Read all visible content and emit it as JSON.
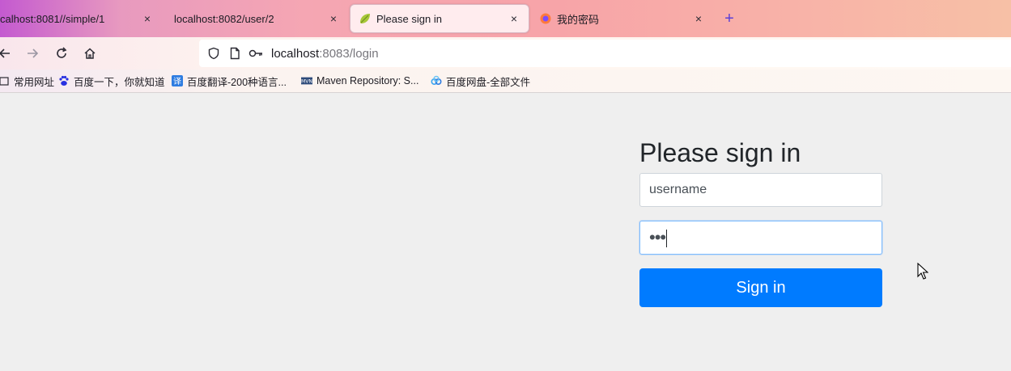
{
  "tabs": [
    {
      "title": "calhost:8081//simple/1",
      "close": "×",
      "active": false
    },
    {
      "title": "localhost:8082/user/2",
      "close": "×",
      "active": false
    },
    {
      "title": "Please sign in",
      "close": "×",
      "active": true
    },
    {
      "title": "我的密码",
      "close": "×",
      "active": false
    }
  ],
  "new_tab": "+",
  "nav": {
    "url_host": "localhost",
    "url_rest": ":8083/login"
  },
  "bookmarks": [
    {
      "label": "常用网址",
      "icon": "folder-icon"
    },
    {
      "label": "百度一下，你就知道",
      "icon": "baidu-paw-icon"
    },
    {
      "label": "百度翻译-200种语言...",
      "icon": "translate-icon"
    },
    {
      "label": "Maven Repository: S...",
      "icon": "maven-icon"
    },
    {
      "label": "百度网盘-全部文件",
      "icon": "baidu-pan-icon"
    }
  ],
  "login": {
    "heading": "Please sign in",
    "username_value": "username",
    "password_value": "•••",
    "button_label": "Sign in"
  },
  "colors": {
    "primary": "#007bff",
    "page_bg": "#efefef"
  }
}
